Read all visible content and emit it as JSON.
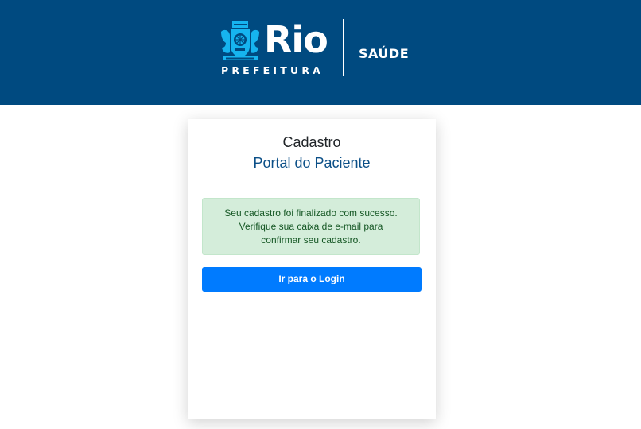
{
  "header": {
    "brand_name": "Rio",
    "brand_sub": "PREFEITURA",
    "section": "SAÚDE",
    "background_color": "#004a80",
    "crest_icon": "city-coat-of-arms-icon"
  },
  "card": {
    "title": "Cadastro",
    "subtitle": "Portal do Paciente",
    "alert": {
      "line1": "Seu cadastro foi finalizado com sucesso.",
      "line2": "Verifique sua caixa de e-mail para",
      "line3": "confirmar seu cadastro.",
      "background_color": "#d4edda",
      "text_color": "#155724"
    },
    "login_button_label": "Ir para o Login",
    "button_color": "#007bff"
  }
}
